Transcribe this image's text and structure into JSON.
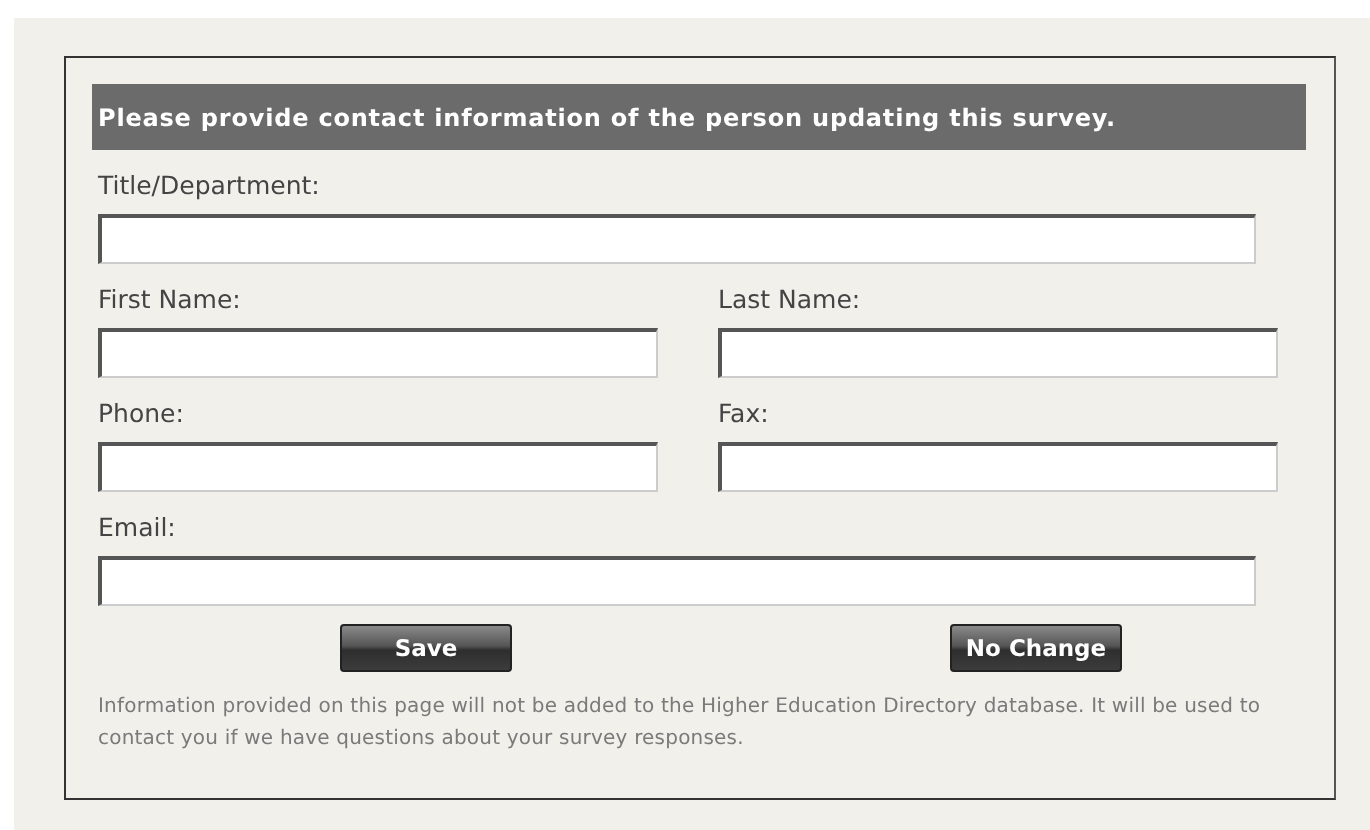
{
  "header": "Please provide contact information of the person updating this survey.",
  "fields": [
    {
      "label": "Title/Department:",
      "wide": true
    },
    {
      "label": "First Name:",
      "wide": false
    },
    {
      "label": "Last Name:",
      "wide": false
    },
    {
      "label": "Phone:",
      "wide": false
    },
    {
      "label": "Fax:",
      "wide": false
    },
    {
      "label": "Email:",
      "wide": true
    }
  ],
  "buttons": [
    "Save",
    "No Change"
  ],
  "note": "Information provided on this page will not be added to the Higher Education Directory database. It will be used to contact you if we have questions about your survey responses."
}
